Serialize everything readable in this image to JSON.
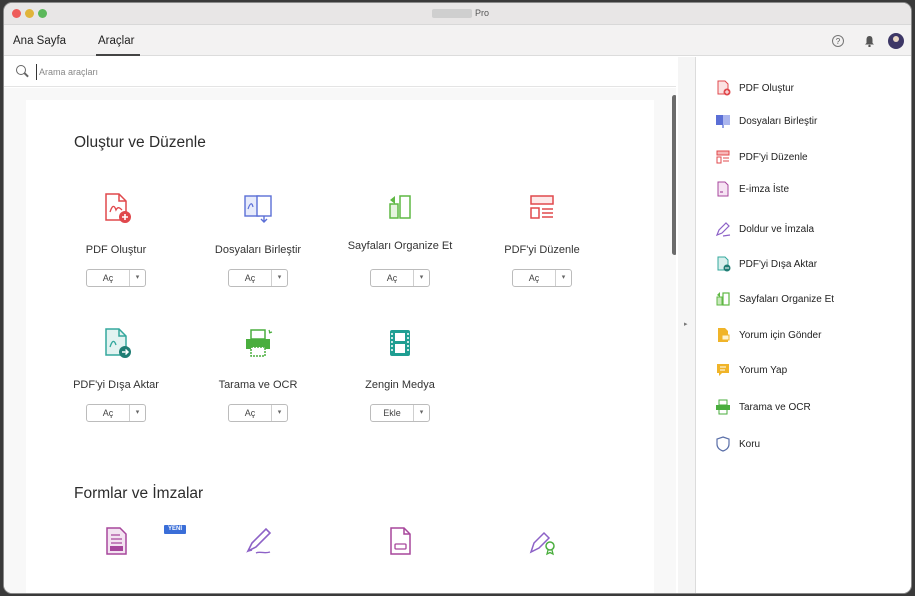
{
  "window": {
    "title": "Pro"
  },
  "menubar": {
    "home": "Ana Sayfa",
    "tools": "Araçlar"
  },
  "search": {
    "placeholder": "Arama araçları"
  },
  "sections": {
    "create_edit": "Oluştur ve Düzenle",
    "forms": "Formlar ve İmzalar"
  },
  "tools": [
    {
      "label": "PDF Oluştur",
      "button": "Aç",
      "icon": "create-pdf-icon"
    },
    {
      "label": "Dosyaları Birleştir",
      "button": "Aç",
      "icon": "combine-files-icon"
    },
    {
      "label": "Sayfaları Organize Et",
      "button": "Aç",
      "icon": "organize-pages-icon"
    },
    {
      "label": "PDF'yi Düzenle",
      "button": "Aç",
      "icon": "edit-pdf-icon"
    },
    {
      "label": "PDF'yi Dışa Aktar",
      "button": "Aç",
      "icon": "export-pdf-icon"
    },
    {
      "label": "Tarama ve OCR",
      "button": "Aç",
      "icon": "scan-ocr-icon"
    },
    {
      "label": "Zengin Medya",
      "button": "Ekle",
      "icon": "rich-media-icon"
    }
  ],
  "forms_tools": {
    "badge": "YENİ",
    "icons": [
      "form-document-icon",
      "fill-sign-pen-icon",
      "document-icon",
      "certificate-pen-icon"
    ]
  },
  "sidebar": {
    "items": [
      {
        "label": "PDF Oluştur",
        "icon": "create-pdf-icon",
        "color": "#e0484c"
      },
      {
        "label": "Dosyaları Birleştir",
        "icon": "combine-files-icon",
        "color": "#5b6fd6"
      },
      {
        "label": "PDF'yi Düzenle",
        "icon": "edit-pdf-icon",
        "color": "#e0484c"
      },
      {
        "label": "E-imza İste",
        "icon": "request-esign-icon",
        "color": "#a7479c"
      },
      {
        "label": "Doldur ve İmzala",
        "icon": "fill-sign-icon",
        "color": "#8d62c7"
      },
      {
        "label": "PDF'yi Dışa Aktar",
        "icon": "export-pdf-icon",
        "color": "#34a89d"
      },
      {
        "label": "Sayfaları Organize Et",
        "icon": "organize-pages-icon",
        "color": "#5fb844"
      },
      {
        "label": "Yorum için Gönder",
        "icon": "send-for-comments-icon",
        "color": "#f0b429"
      },
      {
        "label": "Yorum Yap",
        "icon": "comment-icon",
        "color": "#f0b429"
      },
      {
        "label": "Tarama ve OCR",
        "icon": "scan-ocr-icon",
        "color": "#4aae3e"
      },
      {
        "label": "Koru",
        "icon": "protect-shield-icon",
        "color": "#5a6fa8"
      }
    ]
  }
}
